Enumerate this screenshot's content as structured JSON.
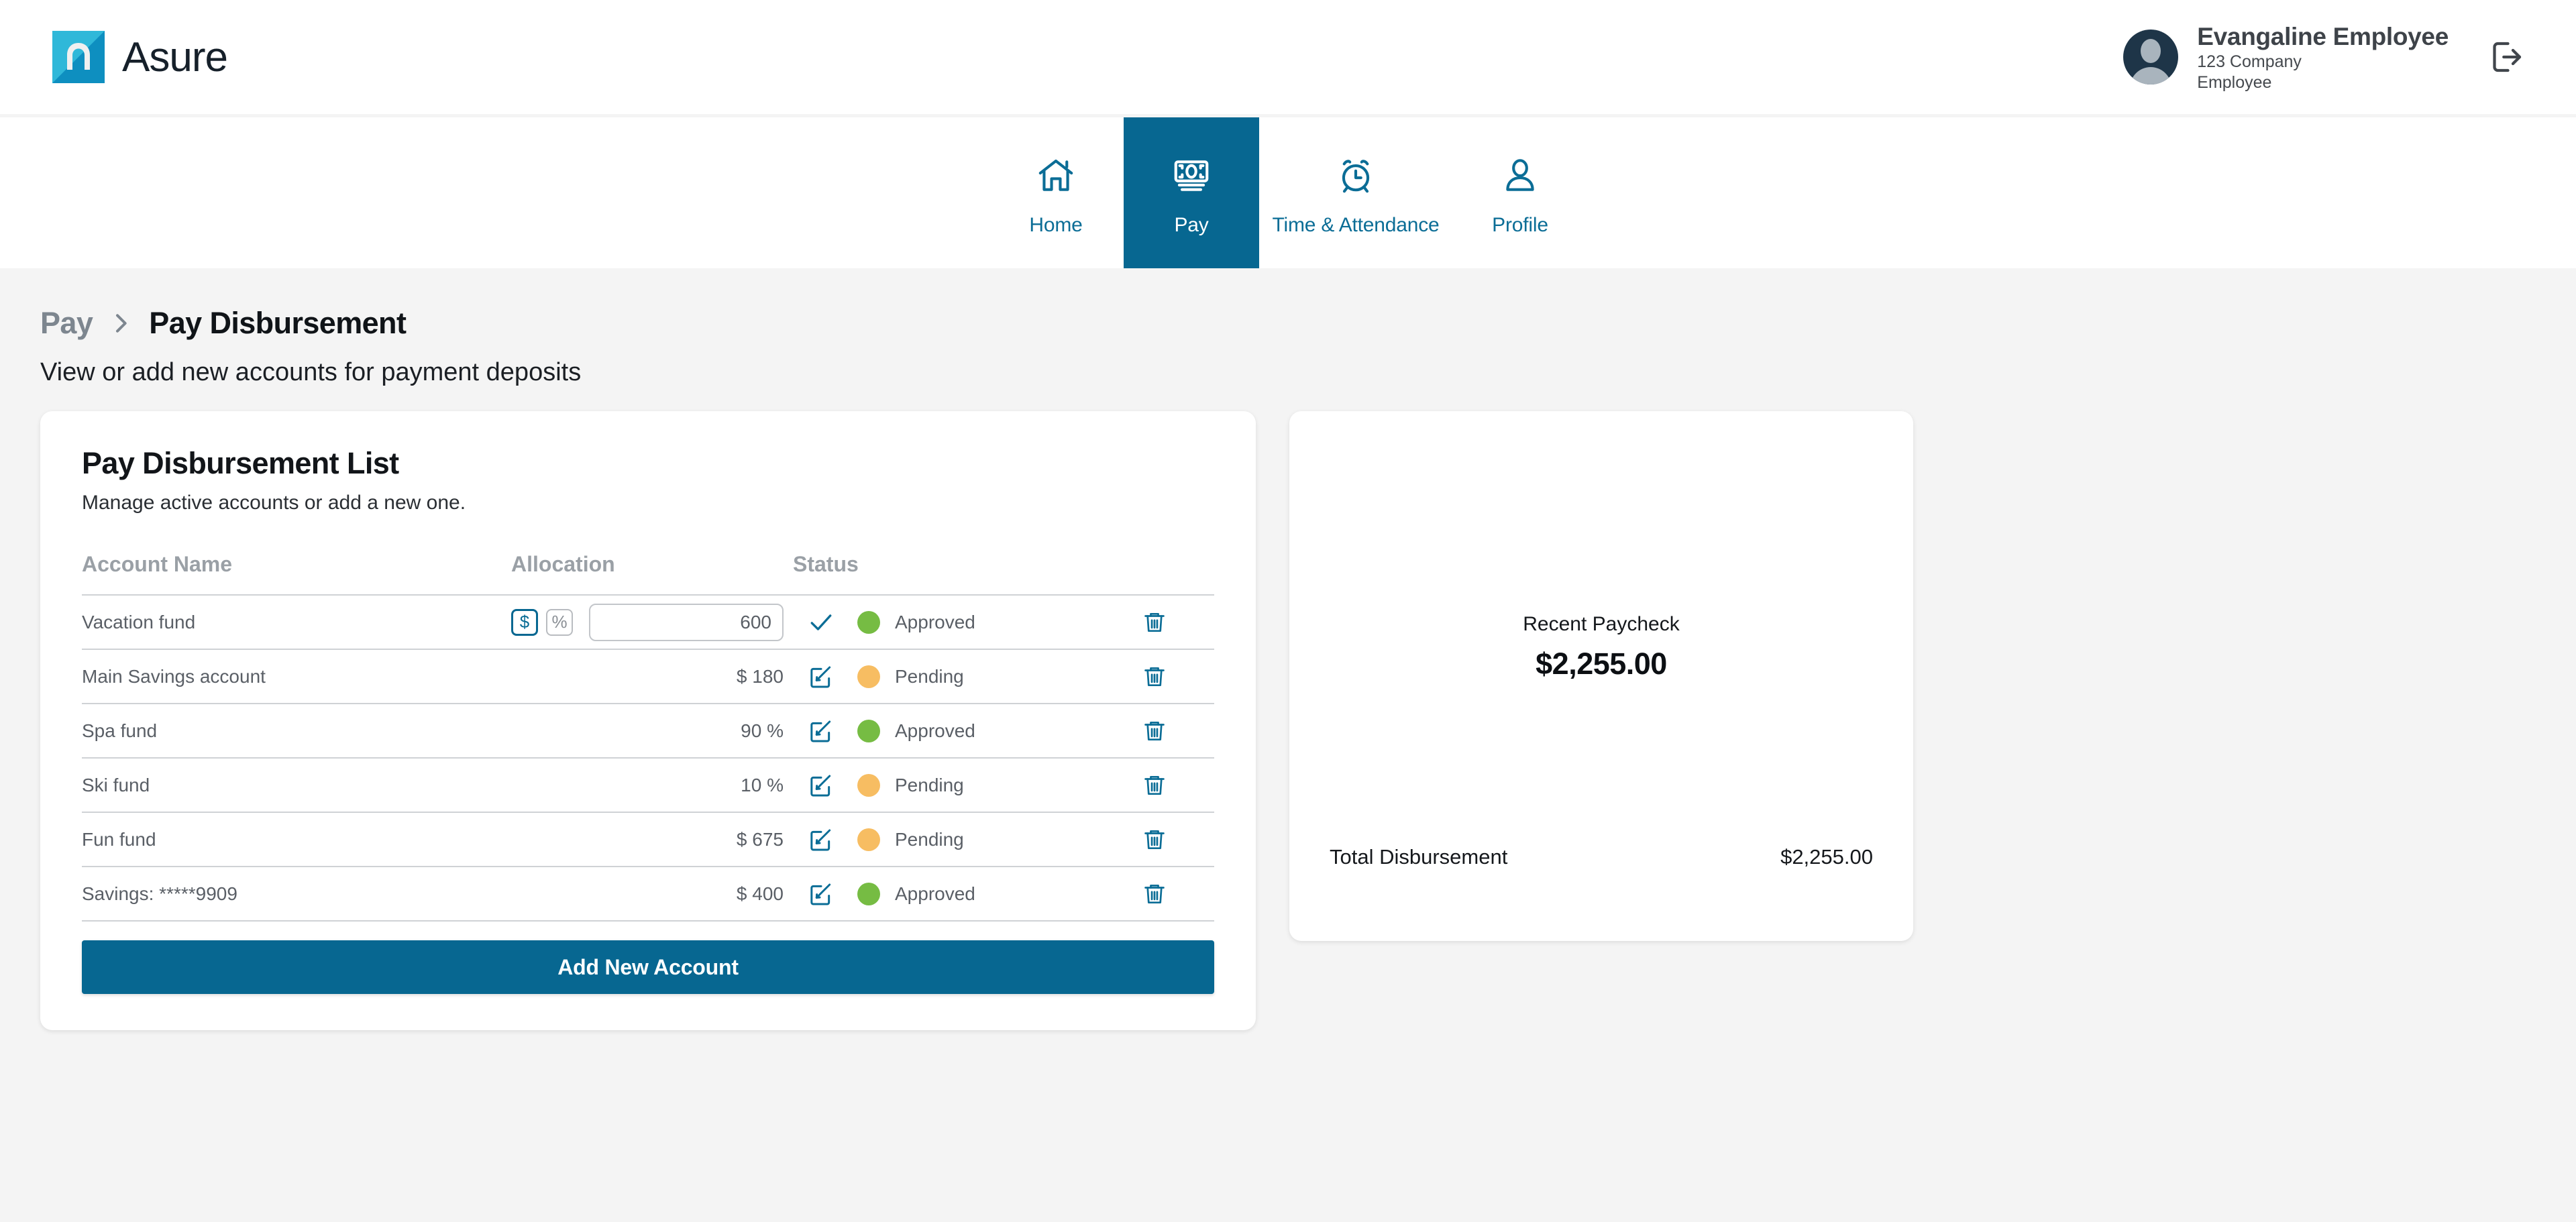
{
  "brand": {
    "name": "Asure",
    "logo_icon": "asure-logo-icon"
  },
  "user": {
    "name": "Evangaline Employee",
    "company": "123 Company",
    "role": "Employee",
    "avatar_icon": "avatar-icon",
    "logout_icon": "logout-icon"
  },
  "nav": {
    "items": [
      {
        "label": "Home",
        "icon": "home-icon",
        "active": false
      },
      {
        "label": "Pay",
        "icon": "money-icon",
        "active": true
      },
      {
        "label": "Time & Attendance",
        "icon": "alarm-clock-icon",
        "active": false
      },
      {
        "label": "Profile",
        "icon": "person-icon",
        "active": false
      }
    ]
  },
  "breadcrumb": {
    "parent": "Pay",
    "separator_icon": "chevron-right-icon",
    "current": "Pay Disbursement"
  },
  "page": {
    "subtitle": "View or add new accounts for payment deposits"
  },
  "list_card": {
    "title": "Pay Disbursement List",
    "description": "Manage active accounts or add a new one.",
    "columns": [
      "Account Name",
      "Allocation",
      "Status"
    ],
    "add_button": "Add New Account",
    "unit_dollar": "$",
    "unit_percent": "%",
    "rows": [
      {
        "name": "Vacation fund",
        "editing": true,
        "input_value": "600",
        "input_placeholder": "",
        "allocation": "",
        "action_icon": "check-icon",
        "status": "Approved",
        "status_color": "#76bc43",
        "delete_icon": "trash-icon"
      },
      {
        "name": "Main Savings account",
        "editing": false,
        "allocation": "$ 180",
        "action_icon": "edit-icon",
        "status": "Pending",
        "status_color": "#f7bd62",
        "delete_icon": "trash-icon"
      },
      {
        "name": "Spa fund",
        "editing": false,
        "allocation": "90 %",
        "action_icon": "edit-icon",
        "status": "Approved",
        "status_color": "#76bc43",
        "delete_icon": "trash-icon"
      },
      {
        "name": "Ski fund",
        "editing": false,
        "allocation": "10 %",
        "action_icon": "edit-icon",
        "status": "Pending",
        "status_color": "#f7bd62",
        "delete_icon": "trash-icon"
      },
      {
        "name": "Fun fund",
        "editing": false,
        "allocation": "$ 675",
        "action_icon": "edit-icon",
        "status": "Pending",
        "status_color": "#f7bd62",
        "delete_icon": "trash-icon"
      },
      {
        "name": "Savings: *****9909",
        "editing": false,
        "allocation": "$ 400",
        "action_icon": "edit-icon",
        "status": "Approved",
        "status_color": "#76bc43",
        "delete_icon": "trash-icon"
      }
    ]
  },
  "paycheck_card": {
    "recent_label": "Recent Paycheck",
    "recent_amount": "$2,255.00",
    "total_label": "Total Disbursement",
    "total_amount": "$2,255.00"
  },
  "colors": {
    "brand_teal": "#0e8fc0",
    "brand_teal_light": "#2fb8d9",
    "accent_blue": "#076791",
    "approved_green": "#76bc43",
    "pending_amber": "#f7bd62",
    "page_bg": "#f4f4f4"
  }
}
